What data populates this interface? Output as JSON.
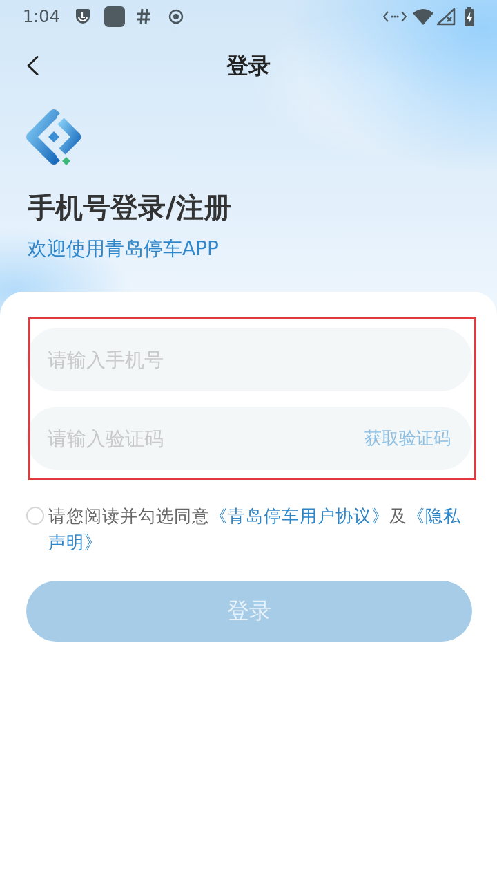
{
  "status_bar": {
    "time": "1:04"
  },
  "header": {
    "title": "登录"
  },
  "intro": {
    "heading": "手机号登录/注册",
    "subtitle": "欢迎使用青岛停车APP"
  },
  "form": {
    "fields": [
      {
        "kind": "phone",
        "placeholder": "请输入手机号"
      },
      {
        "kind": "code",
        "placeholder": "请输入验证码",
        "action": "获取验证码"
      }
    ]
  },
  "agreement": {
    "checked": false,
    "parts": [
      {
        "kind": "text",
        "text": "请您阅读并勾选同意"
      },
      {
        "kind": "link",
        "text": "《青岛停车用户协议》"
      },
      {
        "kind": "text",
        "text": "及"
      },
      {
        "kind": "link",
        "text": "《隐私"
      },
      {
        "kind": "link",
        "text": "声明》"
      }
    ]
  },
  "login_button": {
    "label": "登录",
    "disabled": true
  }
}
